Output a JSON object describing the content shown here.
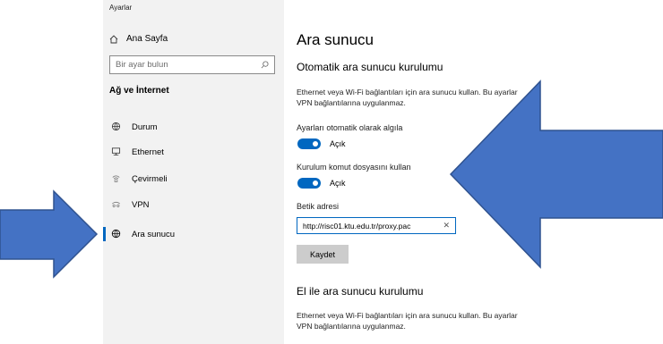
{
  "sidebar": {
    "app_title": "Ayarlar",
    "home_label": "Ana Sayfa",
    "search_placeholder": "Bir ayar bulun",
    "section_title": "Ağ ve İnternet",
    "items": [
      {
        "label": "Durum",
        "icon": "globe-status-icon"
      },
      {
        "label": "Ethernet",
        "icon": "ethernet-icon"
      },
      {
        "label": "Çevirmeli",
        "icon": "dialup-icon"
      },
      {
        "label": "VPN",
        "icon": "vpn-icon"
      },
      {
        "label": "Ara sunucu",
        "icon": "globe-icon",
        "active": true
      }
    ]
  },
  "content": {
    "page_title": "Ara sunucu",
    "auto": {
      "heading": "Otomatik ara sunucu kurulumu",
      "description_line1": "Ethernet veya Wi-Fi bağlantıları için ara sunucu kullan. Bu ayarlar",
      "description_line2": "VPN bağlantılarına uygulanmaz.",
      "detect_label": "Ayarları otomatik olarak algıla",
      "detect_state": "Açık",
      "script_label": "Kurulum komut dosyasını kullan",
      "script_state": "Açık",
      "address_label": "Betik adresi",
      "address_value": "http://risc01.ktu.edu.tr/proxy.pac",
      "save_label": "Kaydet"
    },
    "manual": {
      "heading": "El ile ara sunucu kurulumu",
      "description_line1": "Ethernet veya Wi-Fi bağlantıları için ara sunucu kullan. Bu ayarlar",
      "description_line2": "VPN bağlantılarına uygulanmaz."
    }
  },
  "colors": {
    "accent": "#0067c0",
    "arrow_fill": "#4472c4",
    "arrow_stroke": "#2f528f",
    "sidebar_bg": "#f2f2f2"
  }
}
